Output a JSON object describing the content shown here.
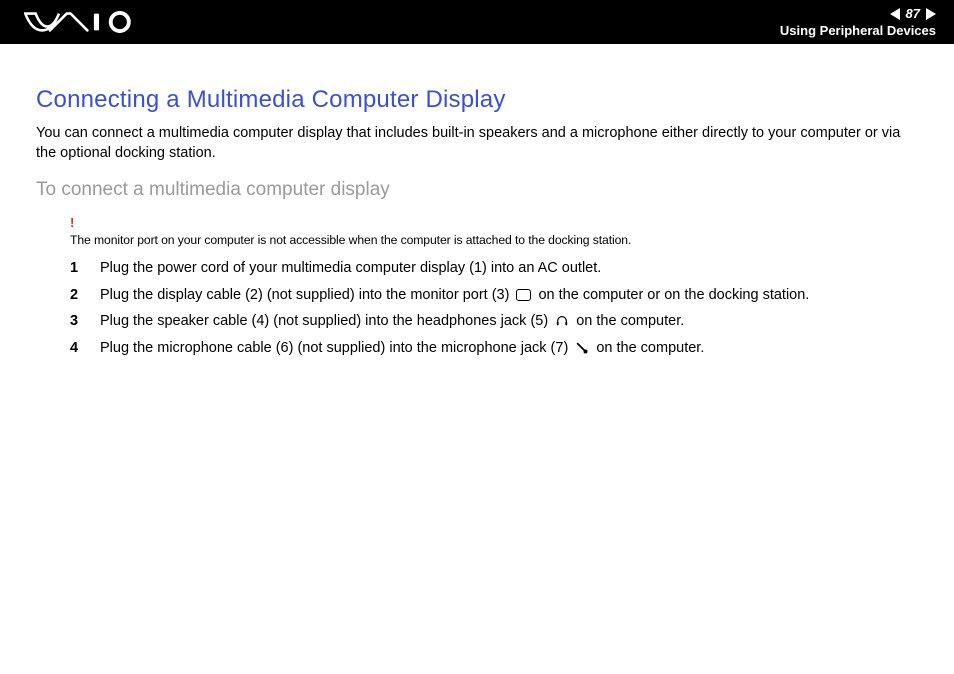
{
  "header": {
    "page_number": "87",
    "section": "Using Peripheral Devices"
  },
  "page": {
    "title": "Connecting a Multimedia Computer Display",
    "intro": "You can connect a multimedia computer display that includes built-in speakers and a microphone either directly to your computer or via the optional docking station.",
    "subhead": "To connect a multimedia computer display",
    "warning_mark": "!",
    "warning_text": "The monitor port on your computer is not accessible when the computer is attached to the docking station.",
    "steps": [
      {
        "n": "1",
        "before": "Plug the power cord of your multimedia computer display (1) into an AC outlet.",
        "icon": null,
        "after": ""
      },
      {
        "n": "2",
        "before": "Plug the display cable (2) (not supplied) into the monitor port (3) ",
        "icon": "monitor",
        "after": " on the computer or on the docking station."
      },
      {
        "n": "3",
        "before": "Plug the speaker cable (4) (not supplied) into the headphones jack (5) ",
        "icon": "headphones",
        "after": " on the computer."
      },
      {
        "n": "4",
        "before": "Plug the microphone cable (6) (not supplied) into the microphone jack (7) ",
        "icon": "mic",
        "after": " on the computer."
      }
    ]
  }
}
